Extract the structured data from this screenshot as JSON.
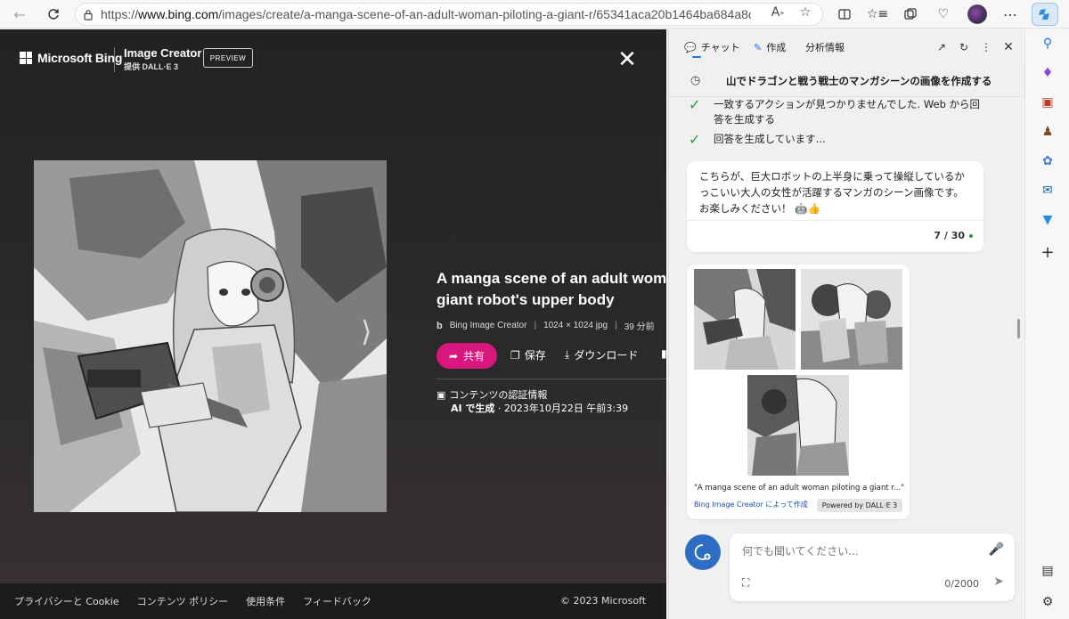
{
  "browser": {
    "url_prefix": "https://",
    "url_domain": "www.bing.com",
    "url_rest": "/images/create/a-manga-scene-of-an-adult-woman-piloting-a-giant-r/65341aca20b1464ba684a8c25de65...",
    "icons": [
      "back-icon",
      "refresh-icon",
      "lock-icon",
      "read-aloud-icon",
      "favorite-star-icon",
      "split-screen-icon",
      "favorites-icon",
      "collections-icon",
      "browser-essentials-icon",
      "profile-avatar",
      "more-icon",
      "copilot-icon"
    ]
  },
  "page": {
    "brand": "Microsoft Bing",
    "product_title": "Image Creator",
    "product_sub": "提供 DALL·E 3",
    "preview_label": "PREVIEW",
    "image_title": "A manga scene of an adult woman\ngiant robot's upper body",
    "title_line1": "A manga scene of an adult woman",
    "title_line2": "giant robot's upper body",
    "meta_source": "Bing Image Creator",
    "meta_size": "1024 × 1024 jpg",
    "meta_time": "39 分前",
    "share_label": "共有",
    "save_label": "保存",
    "download_label": "ダウンロード",
    "credential_label": "コンテンツの認証情報",
    "ai_label": "AI で生成",
    "ai_date": " · 2023年10月22日 午前3:39",
    "footer": {
      "links": [
        "プライバシーと Cookie",
        "コンテンツ ポリシー",
        "使用条件",
        "フィードバック"
      ],
      "copyright": "© 2023 Microsoft"
    }
  },
  "sidebar": {
    "tabs": [
      "チャット",
      "作成",
      "分析情報"
    ],
    "header_title": "山でドラゴンと戦う戦士のマンガシーンの画像を作成する",
    "steps": [
      "一致するアクションが見つかりませんでした. Web から回",
      "答を生成する",
      "回答を生成しています..."
    ],
    "message_line1": "こちらが、巨大ロボットの上半身に乗って操縦しているか",
    "message_line2": "っこいい大人の女性が活躍するマンガのシーン画像です。",
    "message_line3": "お楽しみください！ 🤖👍",
    "counter": "7 / 30",
    "caption": "\"A manga scene of an adult woman piloting a giant r...\"",
    "creator_link": "Bing Image Creator によって作成",
    "powered_badge": "Powered by DALL·E 3",
    "input_placeholder": "何でも聞いてください...",
    "char_count": "0/2000"
  },
  "colors": {
    "accent_pink": "#d8187e",
    "copilot_blue": "#2d6ec4",
    "check_green": "#2a9a3a"
  }
}
